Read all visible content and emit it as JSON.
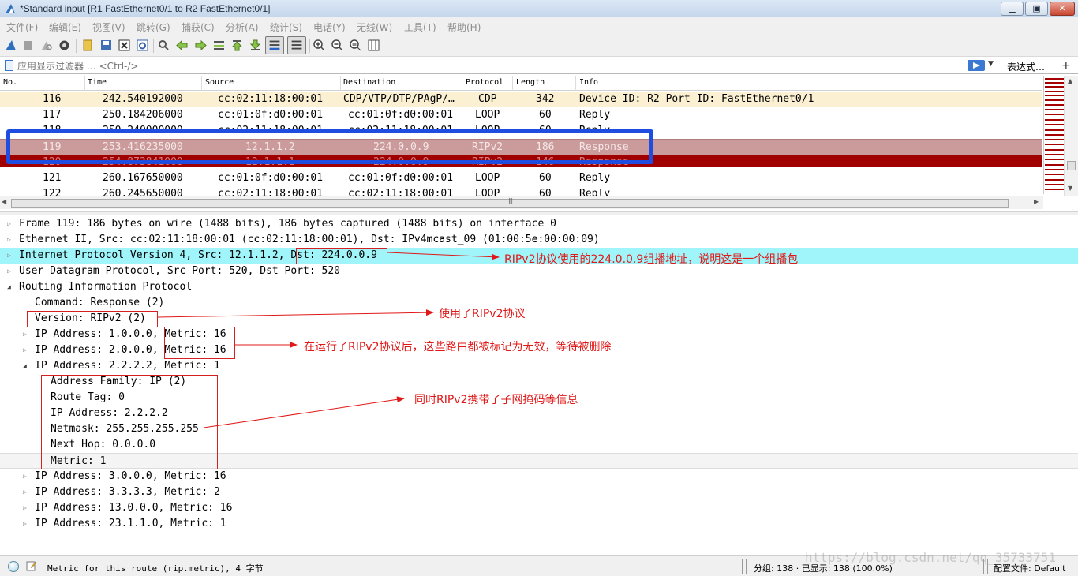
{
  "window": {
    "title": "*Standard input [R1 FastEthernet0/1 to R2 FastEthernet0/1]",
    "buttons": {
      "minimize": "▁",
      "maximize": "▣",
      "close": "✕"
    }
  },
  "menu": [
    {
      "label": "文件(F)"
    },
    {
      "label": "编辑(E)"
    },
    {
      "label": "视图(V)"
    },
    {
      "label": "跳转(G)"
    },
    {
      "label": "捕获(C)"
    },
    {
      "label": "分析(A)"
    },
    {
      "label": "统计(S)"
    },
    {
      "label": "电话(Y)"
    },
    {
      "label": "无线(W)"
    },
    {
      "label": "工具(T)"
    },
    {
      "label": "帮助(H)"
    }
  ],
  "toolbar": {
    "icons": [
      "shark-fin-start-icon",
      "stop-icon",
      "restart-icon",
      "capture-options-icon",
      "open-file-icon",
      "save-file-icon",
      "close-file-icon",
      "reload-file-icon",
      "find-packet-icon",
      "go-back-icon",
      "go-forward-icon",
      "go-to-packet-icon",
      "first-packet-icon",
      "last-packet-icon",
      "auto-scroll-icon",
      "colorize-icon",
      "zoom-in-icon",
      "zoom-out-icon",
      "zoom-normal-icon",
      "resize-columns-icon"
    ]
  },
  "filter": {
    "placeholder": "应用显示过滤器 … <Ctrl-/>",
    "expression_label": "表达式…",
    "add_label": "+"
  },
  "packet_list": {
    "columns": [
      "No.",
      "Time",
      "Source",
      "Destination",
      "Protocol",
      "Length",
      "Info"
    ],
    "rows": [
      {
        "no": "116",
        "time": "242.540192000",
        "source": "cc:02:11:18:00:01",
        "destination": "CDP/VTP/DTP/PAgP/…",
        "protocol": "CDP",
        "length": "342",
        "info": "Device ID: R2  Port ID: FastEthernet0/1"
      },
      {
        "no": "117",
        "time": "250.184206000",
        "source": "cc:01:0f:d0:00:01",
        "destination": "cc:01:0f:d0:00:01",
        "protocol": "LOOP",
        "length": "60",
        "info": "Reply"
      },
      {
        "no": "118",
        "time": "250.240000000",
        "source": "cc:02:11:18:00:01",
        "destination": "cc:02:11:18:00:01",
        "protocol": "LOOP",
        "length": "60",
        "info": "Reply"
      },
      {
        "no": "119",
        "time": "253.416235000",
        "source": "12.1.1.2",
        "destination": "224.0.0.9",
        "protocol": "RIPv2",
        "length": "186",
        "info": "Response"
      },
      {
        "no": "120",
        "time": "254.873841000",
        "source": "12.1.1.1",
        "destination": "224.0.0.9",
        "protocol": "RIPv2",
        "length": "146",
        "info": "Response"
      },
      {
        "no": "121",
        "time": "260.167650000",
        "source": "cc:01:0f:d0:00:01",
        "destination": "cc:01:0f:d0:00:01",
        "protocol": "LOOP",
        "length": "60",
        "info": "Reply"
      },
      {
        "no": "122",
        "time": "260.245650000",
        "source": "cc:02:11:18:00:01",
        "destination": "cc:02:11:18:00:01",
        "protocol": "LOOP",
        "length": "60",
        "info": "Reply"
      }
    ]
  },
  "details": {
    "frame": "Frame 119: 186 bytes on wire (1488 bits), 186 bytes captured (1488 bits) on interface 0",
    "ethernet": "Ethernet II, Src: cc:02:11:18:00:01 (cc:02:11:18:00:01), Dst: IPv4mcast_09 (01:00:5e:00:00:09)",
    "ip": "Internet Protocol Version 4, Src: 12.1.1.2, Dst: 224.0.0.9",
    "udp": "User Datagram Protocol, Src Port: 520, Dst Port: 520",
    "rip": "Routing Information Protocol",
    "command": "Command: Response (2)",
    "version": "Version: RIPv2 (2)",
    "entries_before": [
      "IP Address: 1.0.0.0, Metric: 16",
      "IP Address: 2.0.0.0, Metric: 16"
    ],
    "expanded_entry": "IP Address: 2.2.2.2, Metric: 1",
    "expanded_fields": [
      "Address Family: IP (2)",
      "Route Tag: 0",
      "IP Address: 2.2.2.2",
      "Netmask: 255.255.255.255",
      "Next Hop: 0.0.0.0",
      "Metric: 1"
    ],
    "entries_after": [
      "IP Address: 3.0.0.0, Metric: 16",
      "IP Address: 3.3.3.3, Metric: 2",
      "IP Address: 13.0.0.0, Metric: 16",
      "IP Address: 23.1.1.0, Metric: 1"
    ]
  },
  "annotations": {
    "multicast": "RIPv2协议使用的224.0.0.9组播地址，说明这是一个组播包",
    "version": "使用了RIPv2协议",
    "metric": "在运行了RIPv2协议后，这些路由都被标记为无效，等待被删除",
    "netmask": "同时RIPv2携带了子网掩码等信息",
    "color": "#e01818"
  },
  "status": {
    "field_text": "Metric for this route (rip.metric), 4 字节",
    "packets": "分组: 138 · 已显示: 138 (100.0%)",
    "profile": "配置文件: Default",
    "watermark": "https://blog.csdn.net/qq_35733751"
  },
  "colors": {
    "selected_row": "#cb9a9b",
    "rip_row": "#a00000",
    "cdp_row": "#fbf1d2",
    "ip_highlight": "#a0f5fa",
    "selection_box": "#1f4de0"
  }
}
